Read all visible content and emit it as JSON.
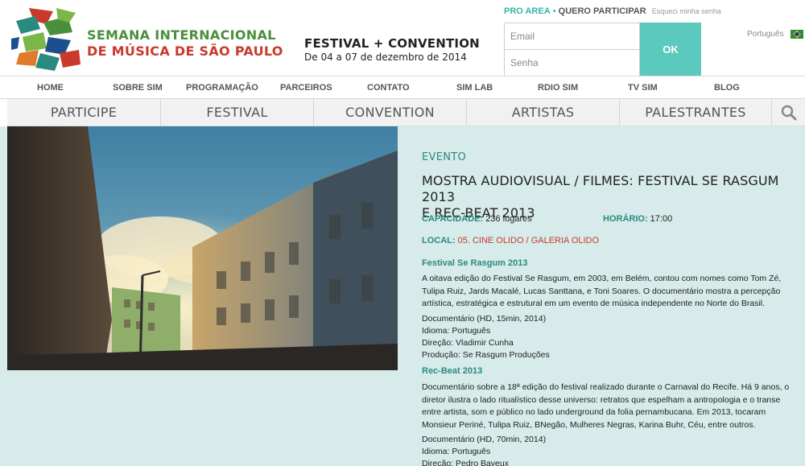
{
  "header": {
    "logo_line1": "SEMANA INTERNACIONAL",
    "logo_line2": "DE MÚSICA DE SÃO PAULO",
    "festival_title": "FESTIVAL + CONVENTION",
    "festival_dates": "De 04 a 07 de dezembro de 2014",
    "pro_area": "PRO AREA",
    "separator": "•",
    "quero_participar": "QUERO PARTICIPAR",
    "forgot_password": "Esqueci minha senha",
    "email_placeholder": "Email",
    "password_placeholder": "Senha",
    "ok_label": "OK",
    "language": "Português",
    "flag_icon": "brazil-flag-icon"
  },
  "nav_primary": [
    "HOME",
    "SOBRE SIM",
    "PROGRAMAÇÃO",
    "PARCEIROS",
    "CONTATO",
    "SIM LAB",
    "RDIO SIM",
    "TV SIM",
    "BLOG"
  ],
  "nav_secondary": [
    "PARTICIPE",
    "FESTIVAL",
    "CONVENTION",
    "ARTISTAS",
    "PALESTRANTES"
  ],
  "search_icon": "search-icon",
  "event": {
    "category": "EVENTO",
    "title_line1": "MOSTRA AUDIOVISUAL / FILMES: FESTIVAL SE RASGUM 2013",
    "title_line2": "E REC-BEAT 2013",
    "capacity_label": "CAPACIDADE:",
    "capacity_value": "236 lugares",
    "time_label": "HORÁRIO:",
    "time_value": "17:00",
    "local_label": "LOCAL:",
    "local_value": "05. CINE OLIDO / GALERIA OLIDO",
    "film1": {
      "heading": "Festival Se Rasgum 2013",
      "description": "A oitava edição do Festival Se Rasgum, em 2003, em Belém, contou com nomes como Tom Zé, Tulipa Ruiz, Jards Macalé, Lucas Santtana, e Toni Soares. O documentário mostra a percepção artística, estratégica e estrutural em um evento de música independente no Norte do Brasil.",
      "format": "Documentário (HD, 15min, 2014)",
      "language": "Idioma: Português",
      "director": "Direção: Vladimir Cunha",
      "producer": "Produção: Se Rasgum Produções"
    },
    "film2": {
      "heading": "Rec-Beat 2013",
      "description": "Documentário sobre a 18ª edição do festival realizado durante o Carnaval do Recife. Há 9 anos, o diretor ilustra o lado ritualístico desse universo: retratos que espelham a antropologia e o transe entre artista, som e público no lado underground da folia pernambucana. Em 2013, tocaram Monsieur Periné, Tulipa Ruiz, BNegão, Mulheres Negras, Karina Buhr, Céu, entre outros.",
      "format": "Documentário (HD, 70min, 2014)",
      "language": "Idioma: Português",
      "director": "Direção: Pedro Bayeux"
    }
  },
  "colors": {
    "accent_teal": "#2fb5a8",
    "ok_button": "#5bc9bd",
    "content_bg": "#d6ebea",
    "link_red": "#c93a2d"
  }
}
